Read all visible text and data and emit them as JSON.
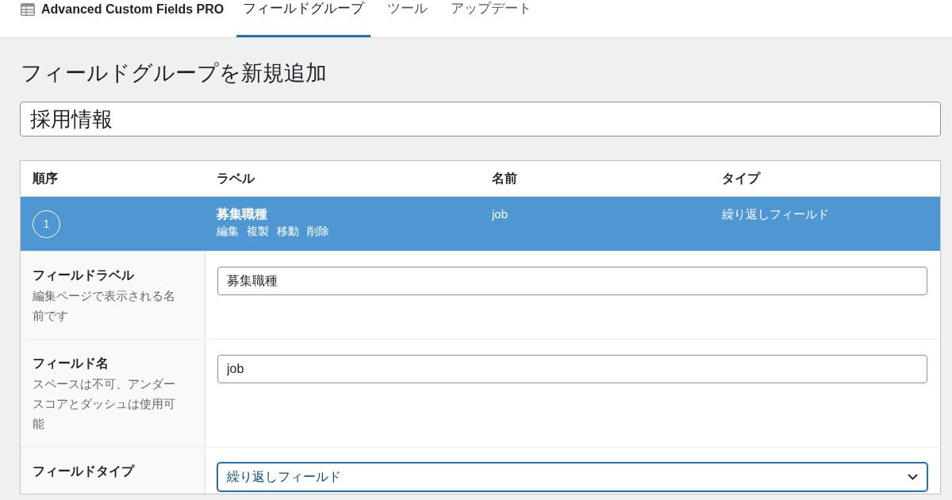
{
  "header": {
    "app_title": "Advanced Custom Fields PRO",
    "tabs": [
      {
        "label": "フィールドグループ",
        "selected": true
      },
      {
        "label": "ツール",
        "selected": false
      },
      {
        "label": "アップデート",
        "selected": false
      }
    ]
  },
  "page": {
    "heading": "フィールドグループを新規追加",
    "title_field": {
      "value": "採用情報"
    }
  },
  "fields_table": {
    "columns": [
      "順序",
      "ラベル",
      "名前",
      "タイプ"
    ],
    "rows": [
      {
        "order": "1",
        "label": "募集職種",
        "actions": [
          "編集",
          "複製",
          "移動",
          "削除"
        ],
        "name": "job",
        "type": "繰り返しフィールド",
        "selected": true
      }
    ]
  },
  "field_settings": [
    {
      "kind": "text",
      "label": "フィールドラベル",
      "description": "編集ページで表示される名前です",
      "value": "募集職種",
      "focused": false
    },
    {
      "kind": "text",
      "label": "フィールド名",
      "description": "スペースは不可、アンダースコアとダッシュは使用可能",
      "value": "job",
      "focused": false
    },
    {
      "kind": "select",
      "label": "フィールドタイプ",
      "value": "繰り返しフィールド",
      "focused": true
    }
  ]
}
